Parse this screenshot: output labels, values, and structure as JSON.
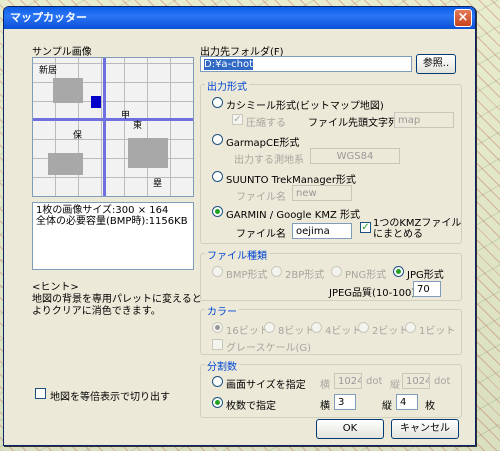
{
  "window": {
    "title": "マップカッター",
    "close": "×"
  },
  "left": {
    "sample_label": "サンプル画像",
    "map_tokens": [
      "新居",
      "保",
      "東",
      "甲",
      "塁"
    ],
    "info_line1": "1枚の画像サイズ:300 × 164",
    "info_line2": "全体の必要容量(BMP時):1156KB",
    "hint_title": "<ヒント>",
    "hint_text1": "地図の背景を専用パレットに変えると",
    "hint_text2": "よりクリアに消色できます。",
    "equal_display_label": "地図を等倍表示で切り出す"
  },
  "output_folder": {
    "label": "出力先フォルダ(F)",
    "value": "D:¥a-chot",
    "browse": "参照.."
  },
  "output_format": {
    "title": "出力形式",
    "kashmir": {
      "label": "カシミール形式(ビットマップ地図)",
      "compress": "圧縮する",
      "prefix_label": "ファイル先頭文字列",
      "prefix_value": "map"
    },
    "garmapce": {
      "label": "GarmapCE形式",
      "datum_label": "出力する測地系",
      "datum_value": "WGS84"
    },
    "suunto": {
      "label": "SUUNTO TrekManager形式",
      "file_label": "ファイル名",
      "file_value": "new"
    },
    "garmin": {
      "label": "GARMIN / Google KMZ 形式",
      "file_label": "ファイル名",
      "file_value": "oejima",
      "combine_line1": "1つのKMZファイル",
      "combine_line2": "にまとめる"
    }
  },
  "file_type": {
    "title": "ファイル種類",
    "bmp": "BMP形式",
    "png2": "2BP形式",
    "png": "PNG形式",
    "jpg": "JPG形式",
    "quality_label": "JPEG品質(10-100)",
    "quality_value": "70"
  },
  "color": {
    "title": "カラー",
    "b16": "16ビット",
    "b8": "8ビット",
    "b4": "4ビット",
    "b2": "2ビット",
    "b1": "1ビット",
    "grayscale": "グレースケール(G)"
  },
  "split": {
    "title": "分割数",
    "screen_size": "画面サイズを指定",
    "width_label": "横",
    "width_value": "1024",
    "height_label": "縦",
    "height_value": "1024",
    "unit_dot": "dot",
    "sheet_count": "枚数で指定",
    "cols_label": "横",
    "cols_value": "3",
    "rows_label": "縦",
    "rows_value": "4",
    "unit_sheet": "枚"
  },
  "buttons": {
    "ok": "OK",
    "cancel": "キャンセル"
  },
  "colors": {
    "title_bar": "#0a5ce8",
    "group_title": "#0046d5",
    "dialog_bg": "#ece9d8"
  }
}
